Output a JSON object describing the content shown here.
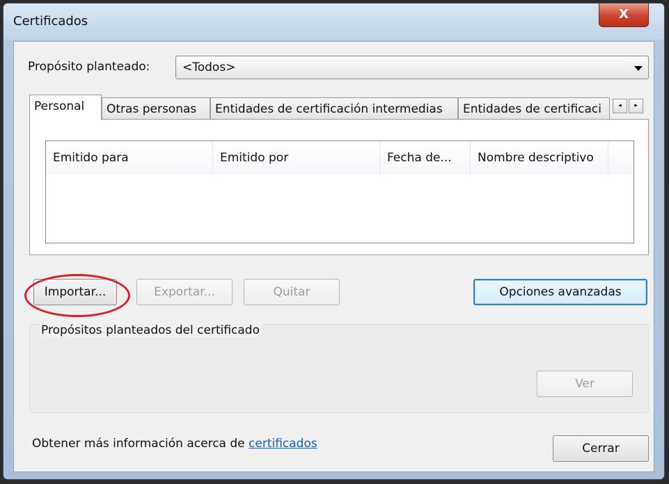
{
  "window": {
    "title": "Certificados",
    "close_label": "X"
  },
  "purpose": {
    "label": "Propósito planteado:",
    "value": "<Todos>"
  },
  "tabs": [
    {
      "label": "Personal"
    },
    {
      "label": "Otras personas"
    },
    {
      "label": "Entidades de certificación intermedias"
    },
    {
      "label": "Entidades de certificaci"
    }
  ],
  "tab_scroll": {
    "left": "◂",
    "right": "▸"
  },
  "list": {
    "columns": [
      "Emitido para",
      "Emitido por",
      "Fecha de...",
      "Nombre descriptivo"
    ]
  },
  "buttons": {
    "import": "Importar...",
    "export": "Exportar...",
    "remove": "Quitar",
    "advanced": "Opciones avanzadas",
    "view": "Ver",
    "close": "Cerrar"
  },
  "group": {
    "title": "Propósitos planteados del certificado"
  },
  "footer": {
    "text": "Obtener más información acerca de ",
    "link": "certificados"
  },
  "colors": {
    "highlight": "#d81f27",
    "link": "#0a5fc1"
  }
}
